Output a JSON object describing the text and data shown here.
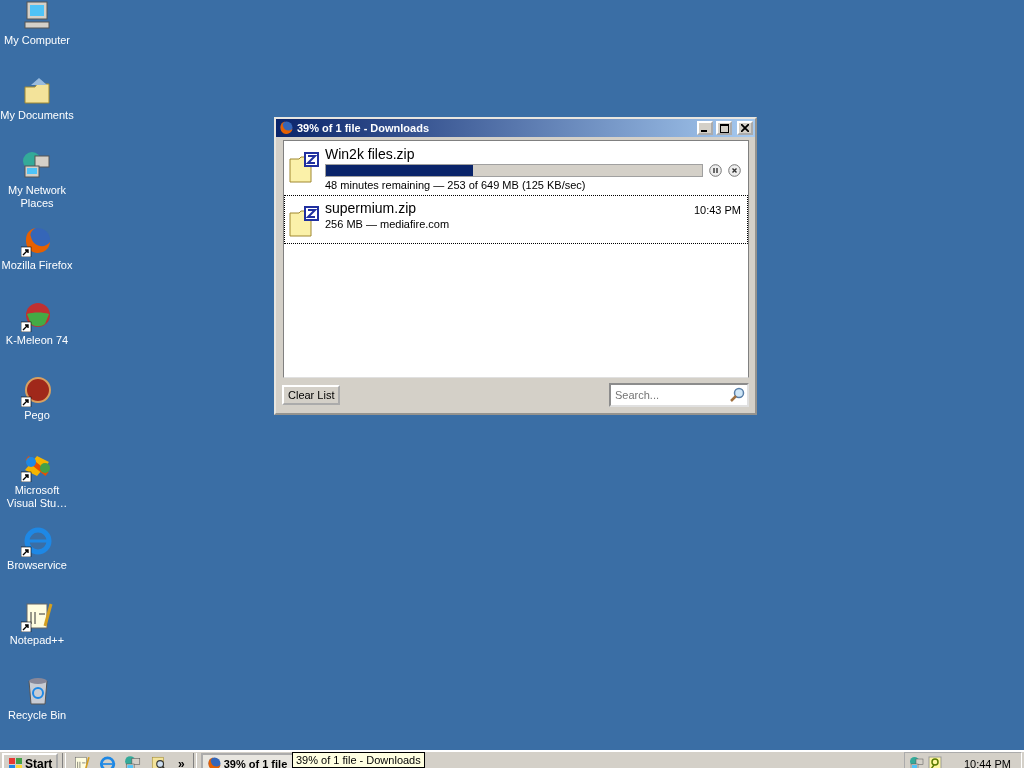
{
  "desktop_icons": [
    {
      "label": "My Computer",
      "kind": "computer",
      "shortcut": false
    },
    {
      "label": "My Documents",
      "kind": "documents",
      "shortcut": false
    },
    {
      "label": "My Network Places",
      "kind": "network",
      "shortcut": false
    },
    {
      "label": "Mozilla Firefox",
      "kind": "firefox",
      "shortcut": true
    },
    {
      "label": "K-Meleon 74",
      "kind": "kmeleon",
      "shortcut": true
    },
    {
      "label": "Pego",
      "kind": "pego",
      "shortcut": true
    },
    {
      "label": "Microsoft Visual Stu…",
      "kind": "vs",
      "shortcut": true
    },
    {
      "label": "Browservice",
      "kind": "ie",
      "shortcut": true
    },
    {
      "label": "Notepad++",
      "kind": "notepad",
      "shortcut": true
    },
    {
      "label": "Recycle Bin",
      "kind": "recycle",
      "shortcut": false
    }
  ],
  "window": {
    "title": "39% of 1 file - Downloads",
    "downloads": [
      {
        "name": "Win2k files.zip",
        "kind": "active",
        "level": 0.39,
        "status": "48 minutes remaining — 253 of 649 MB (125 KB/sec)",
        "selected": false
      },
      {
        "name": "supermium.zip",
        "kind": "done",
        "time": "10:43 PM",
        "status": "256 MB — mediafire.com",
        "selected": true
      }
    ],
    "clear_button": "Clear List",
    "search": {
      "placeholder": "Search..."
    }
  },
  "taskbar": {
    "start": "Start",
    "quick_launch": [
      {
        "kind": "notepad"
      },
      {
        "kind": "ie"
      },
      {
        "kind": "network"
      },
      {
        "kind": "search"
      }
    ],
    "chevron": "»",
    "tasks": [
      {
        "label": "39% of 1 file",
        "selected": true
      }
    ],
    "tooltip": "39% of 1 file - Downloads",
    "clock": "10:44 PM"
  }
}
